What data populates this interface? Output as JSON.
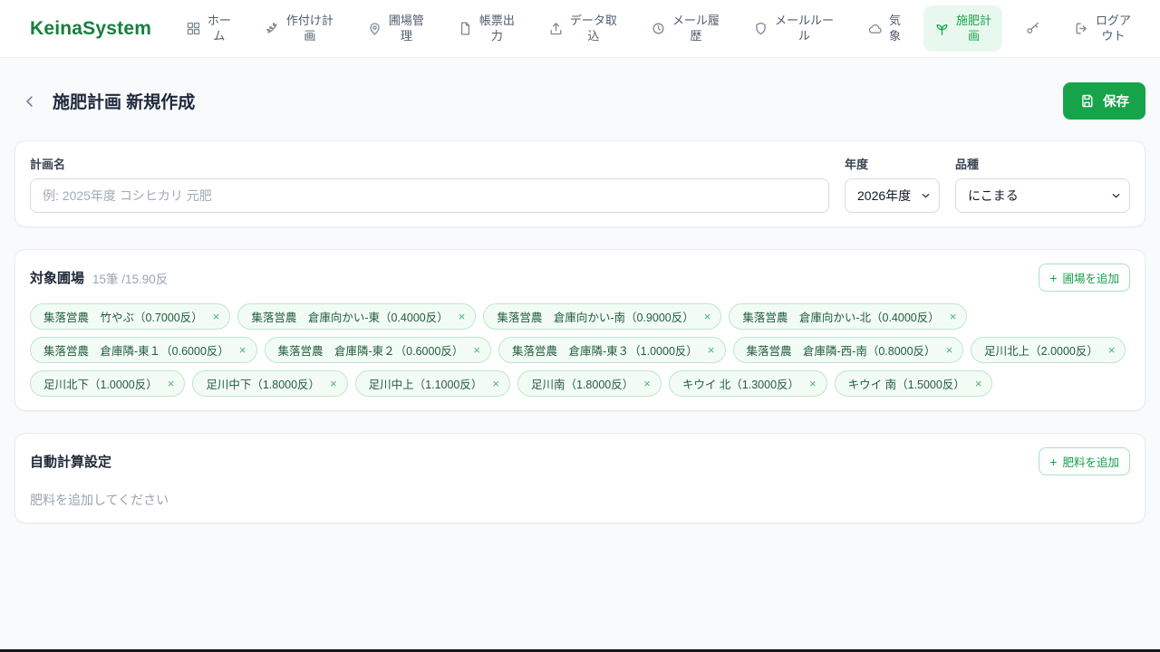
{
  "brand": {
    "name": "KeinaSystem"
  },
  "glyphs": {
    "plus": "+",
    "close": "×"
  },
  "colors": {
    "brand_green": "#15803d",
    "accent_green": "#17a34a",
    "active_nav_bg": "#e9f8ef",
    "chip_bg": "#f2fcf5",
    "chip_border": "#bce8cb",
    "chip_text": "#235c3e",
    "page_bg": "#f8fafc"
  },
  "nav": {
    "items": [
      {
        "id": "home",
        "icon": "grid-icon",
        "label_lines": [
          "ホー",
          "ム"
        ],
        "active": false
      },
      {
        "id": "planting-plan",
        "icon": "wheat-icon",
        "label_lines": [
          "作付け計",
          "画"
        ],
        "active": false
      },
      {
        "id": "field-management",
        "icon": "map-pin-icon",
        "label_lines": [
          "圃場管",
          "理"
        ],
        "active": false
      },
      {
        "id": "report-output",
        "icon": "document-icon",
        "label_lines": [
          "帳票出",
          "力"
        ],
        "active": false
      },
      {
        "id": "data-import",
        "icon": "upload-icon",
        "label_lines": [
          "データ取",
          "込"
        ],
        "active": false
      },
      {
        "id": "mail-history",
        "icon": "history-icon",
        "label_lines": [
          "メール履",
          "歴"
        ],
        "active": false
      },
      {
        "id": "mail-rules",
        "icon": "shield-icon",
        "label_lines": [
          "メールルー",
          "ル"
        ],
        "active": false
      },
      {
        "id": "weather",
        "icon": "cloud-icon",
        "label_lines": [
          "気",
          "象"
        ],
        "active": false
      },
      {
        "id": "fertilization-plan",
        "icon": "sprout-icon",
        "label_lines": [
          "施肥計",
          "画"
        ],
        "active": true
      },
      {
        "id": "key",
        "icon": "key-icon",
        "label_lines": [],
        "active": false
      },
      {
        "id": "logout",
        "icon": "logout-icon",
        "label_lines": [
          "ログア",
          "ウト"
        ],
        "active": false
      }
    ]
  },
  "page": {
    "title": "施肥計画 新規作成",
    "save_label": "保存"
  },
  "form": {
    "plan_name": {
      "label": "計画名",
      "placeholder": "例: 2025年度 コシヒカリ 元肥",
      "value": ""
    },
    "year": {
      "label": "年度",
      "value": "2026年度"
    },
    "variety": {
      "label": "品種",
      "value": "にこまる"
    }
  },
  "fields_section": {
    "title": "対象圃場",
    "count_text": "15筆 /15.90反",
    "add_button": "圃場を追加",
    "chips": [
      {
        "label": "集落営農　竹やぶ（0.7000反）"
      },
      {
        "label": "集落営農　倉庫向かい-東（0.4000反）"
      },
      {
        "label": "集落営農　倉庫向かい-南（0.9000反）"
      },
      {
        "label": "集落営農　倉庫向かい-北（0.4000反）"
      },
      {
        "label": "集落営農　倉庫隣-東１（0.6000反）"
      },
      {
        "label": "集落営農　倉庫隣-東２（0.6000反）"
      },
      {
        "label": "集落営農　倉庫隣-東３（1.0000反）"
      },
      {
        "label": "集落営農　倉庫隣-西-南（0.8000反）"
      },
      {
        "label": "足川北上（2.0000反）"
      },
      {
        "label": "足川北下（1.0000反）"
      },
      {
        "label": "足川中下（1.8000反）"
      },
      {
        "label": "足川中上（1.1000反）"
      },
      {
        "label": "足川南（1.8000反）"
      },
      {
        "label": "キウイ 北（1.3000反）"
      },
      {
        "label": "キウイ 南（1.5000反）"
      }
    ]
  },
  "fertilizer_section": {
    "title": "自動計算設定",
    "add_button": "肥料を追加",
    "empty_text": "肥料を追加してください"
  }
}
